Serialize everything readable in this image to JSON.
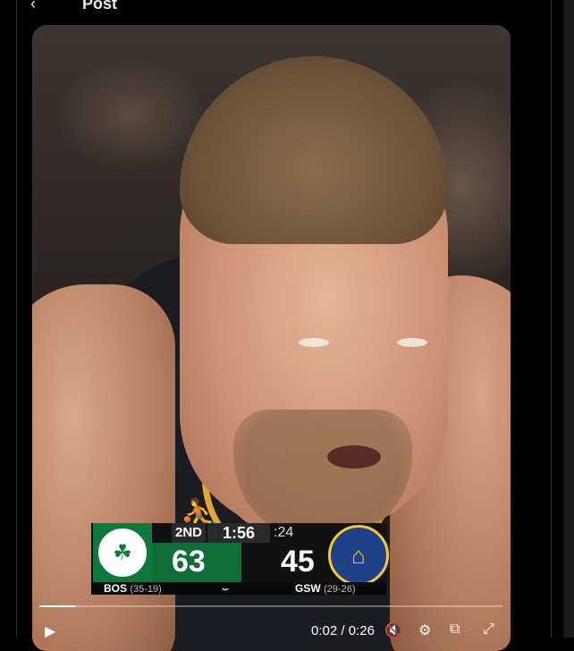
{
  "header": {
    "back_icon": "arrow-left-icon",
    "back_glyph": "‹",
    "title": "Post"
  },
  "video": {
    "scorebug": {
      "period": "2ND",
      "clock": "1:56",
      "shot_clock": ":24",
      "home": {
        "abbr": "BOS",
        "record": "(35-19)",
        "score": "63",
        "color": "#0d7a3c"
      },
      "away": {
        "abbr": "GSW",
        "record": "(29-26)",
        "score": "45",
        "color": "#1d428a"
      },
      "sponsor_glyph": "⌣"
    },
    "player": {
      "current_time": "0:02",
      "separator": "/",
      "duration": "0:26",
      "progress_fraction": 0.077,
      "play_icon": "play-icon",
      "mute_icon": "mute-icon",
      "settings_icon": "settings-icon",
      "pip_icon": "pip-icon",
      "fullscreen_icon": "fullscreen-icon"
    }
  }
}
